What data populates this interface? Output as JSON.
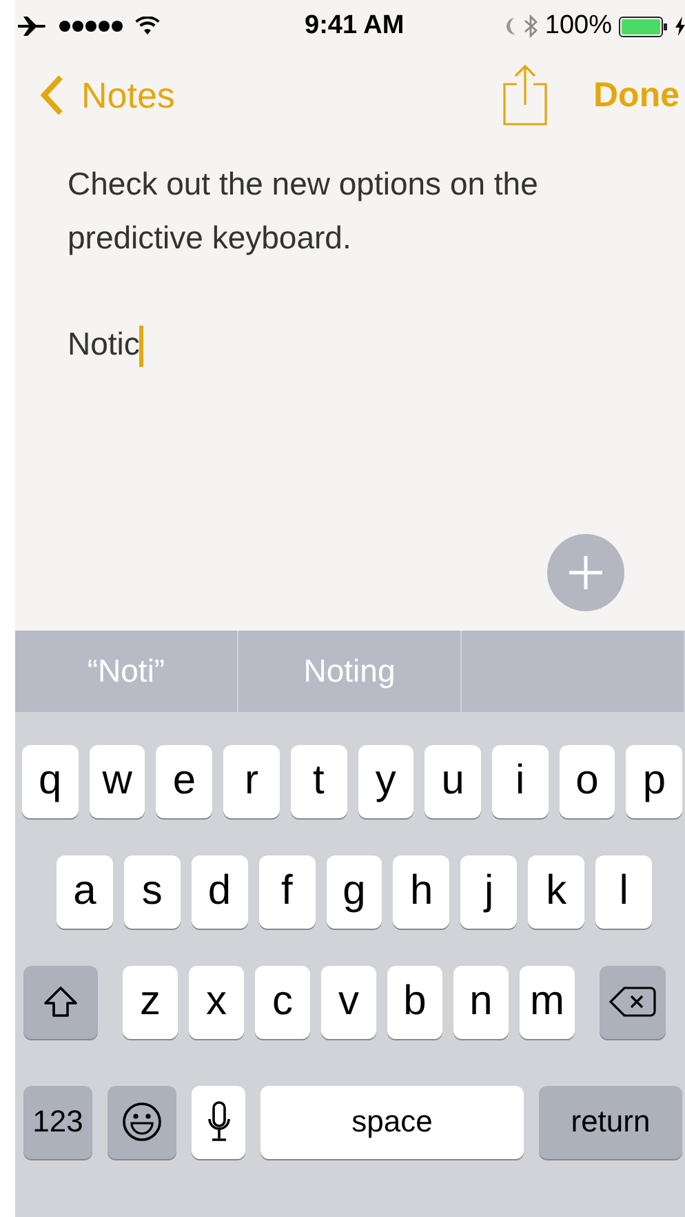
{
  "status_bar": {
    "time": "9:41 AM",
    "battery": "100%"
  },
  "nav": {
    "back": "Notes",
    "done": "Done"
  },
  "note": {
    "paragraphs": [
      "Check out the new options on the predictive keyboard.",
      "Notic"
    ],
    "cursor": true
  },
  "predictions": [
    "“Noti”",
    "Noting"
  ],
  "keyboard": {
    "top_row": [
      {
        "kind": "letter",
        "label": "q"
      },
      {
        "kind": "letter",
        "label": "w"
      },
      {
        "kind": "letter",
        "label": "e"
      },
      {
        "kind": "letter",
        "label": "r"
      },
      {
        "kind": "letter",
        "label": "t"
      },
      {
        "kind": "letter",
        "label": "y"
      },
      {
        "kind": "letter",
        "label": "u"
      },
      {
        "kind": "letter",
        "label": "i"
      },
      {
        "kind": "letter",
        "label": "o"
      },
      {
        "kind": "letter",
        "label": "p"
      }
    ],
    "home_row": [
      {
        "kind": "letter",
        "label": "a"
      },
      {
        "kind": "letter",
        "label": "s"
      },
      {
        "kind": "letter",
        "label": "d"
      },
      {
        "kind": "letter",
        "label": "f"
      },
      {
        "kind": "letter",
        "label": "g"
      },
      {
        "kind": "letter",
        "label": "h"
      },
      {
        "kind": "letter",
        "label": "j"
      },
      {
        "kind": "letter",
        "label": "k"
      },
      {
        "kind": "letter",
        "label": "l"
      }
    ],
    "lower_row": [
      {
        "kind": "shift"
      },
      {
        "kind": "letter",
        "label": "z"
      },
      {
        "kind": "letter",
        "label": "x"
      },
      {
        "kind": "letter",
        "label": "c"
      },
      {
        "kind": "letter",
        "label": "v"
      },
      {
        "kind": "letter",
        "label": "b"
      },
      {
        "kind": "letter",
        "label": "n"
      },
      {
        "kind": "letter",
        "label": "m"
      },
      {
        "kind": "delete"
      }
    ],
    "bottom_row": [
      {
        "kind": "numbers",
        "label": "123"
      },
      {
        "kind": "emoji"
      },
      {
        "kind": "mic"
      },
      {
        "kind": "space",
        "label": "space"
      },
      {
        "kind": "return",
        "label": "return"
      }
    ]
  }
}
